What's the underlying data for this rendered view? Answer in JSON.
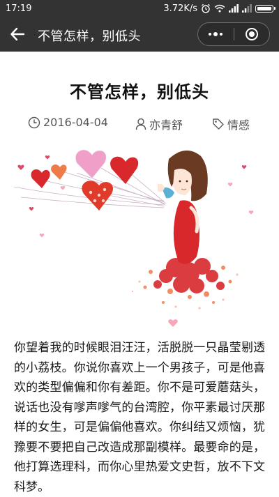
{
  "status_bar": {
    "time": "17:19",
    "network_speed": "3.72K/s"
  },
  "nav": {
    "title": "不管怎样，别低头",
    "back_icon": "arrow-left-icon",
    "more_icon": "more-dots-icon",
    "close_icon": "target-circle-icon"
  },
  "article": {
    "title": "不管怎样，别低头",
    "meta": {
      "date": "2016-04-04",
      "author": "亦青舒",
      "category": "情感"
    },
    "body": "你望着我的时候眼泪汪汪，活脱脱一只晶莹剔透的小荔枝。你说你喜欢上一个男孩子，可是他喜欢的类型偏偏和你有差距。你不是可爱蘑菇头，说话也没有嗲声嗲气的台湾腔，你平素最讨厌那样的女生，可是偏偏他喜欢。你纠结又烦恼，犹豫要不要把自己改造成那副模样。最要命的是，他打算选理科，而你心里热爱文史哲，放不下文科梦。"
  },
  "colors": {
    "bar_background": "#333333",
    "text": "#1a1a1a",
    "meta_text": "#555555",
    "accent_red": "#d8282c"
  }
}
